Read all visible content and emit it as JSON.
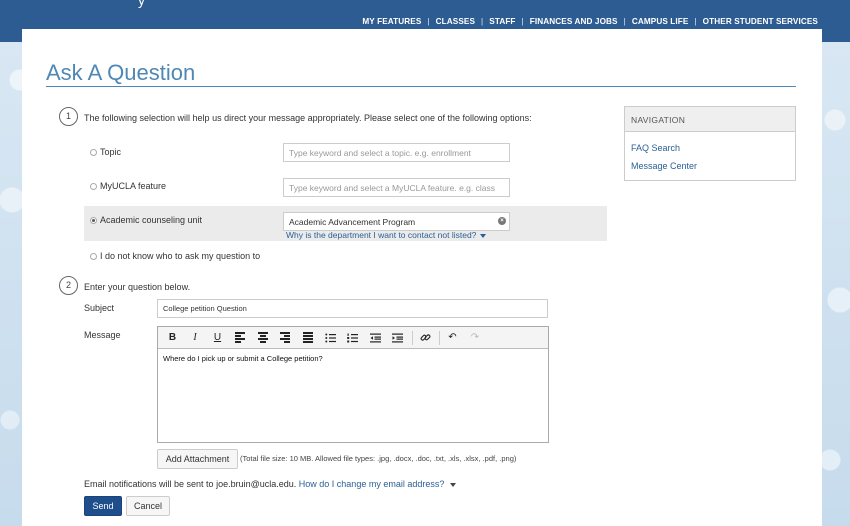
{
  "header": {
    "brand_fragment": "y",
    "nav": [
      "MY FEATURES",
      "CLASSES",
      "STAFF",
      "FINANCES AND JOBS",
      "CAMPUS LIFE",
      "OTHER STUDENT SERVICES"
    ],
    "nav_separator": "|"
  },
  "page_title": "Ask A Question",
  "step1": {
    "number": "1",
    "instruction": "The following selection will help us direct your message appropriately. Please select one of the following options:",
    "options": [
      {
        "label": "Topic",
        "placeholder": "Type keyword and select a topic. e.g. enrollment",
        "value": "",
        "checked": false
      },
      {
        "label": "MyUCLA feature",
        "placeholder": "Type keyword and select a MyUCLA feature. e.g. class",
        "value": "",
        "checked": false
      },
      {
        "label": "Academic counseling unit",
        "placeholder": "",
        "value": "Academic Advancement Program",
        "checked": true
      },
      {
        "label": "I do not know who to ask my question to",
        "checked": false
      }
    ],
    "dept_link": "Why is the department I want to contact not listed?",
    "clear_glyph": "×"
  },
  "step2": {
    "number": "2",
    "instruction": "Enter your question below.",
    "subject_label": "Subject",
    "subject_value": "College petition Question",
    "message_label": "Message",
    "message_value": "Where do I pick up or submit a College petition?",
    "attachment_button": "Add Attachment",
    "attachment_note": "(Total file size: 10 MB. Allowed file types: .jpg, .docx, .doc, .txt, .xls, .xlsx, .pdf, .png)"
  },
  "toolbar": {
    "bold": "B",
    "italic": "I",
    "underline": "U",
    "undo": "↶",
    "redo": "↷",
    "link": "🔗"
  },
  "email": {
    "prefix": "Email notifications will be sent to",
    "address": "joe.bruin@ucla.edu.",
    "change_link": "How do I change my email address?"
  },
  "actions": {
    "send": "Send",
    "cancel": "Cancel"
  },
  "sidebar": {
    "heading": "NAVIGATION",
    "links": [
      "FAQ Search",
      "Message Center"
    ]
  },
  "colors": {
    "header_bg": "#2d5c92",
    "title": "#4f88b5",
    "link": "#2a5f96",
    "primary_button": "#1e4e8c"
  }
}
